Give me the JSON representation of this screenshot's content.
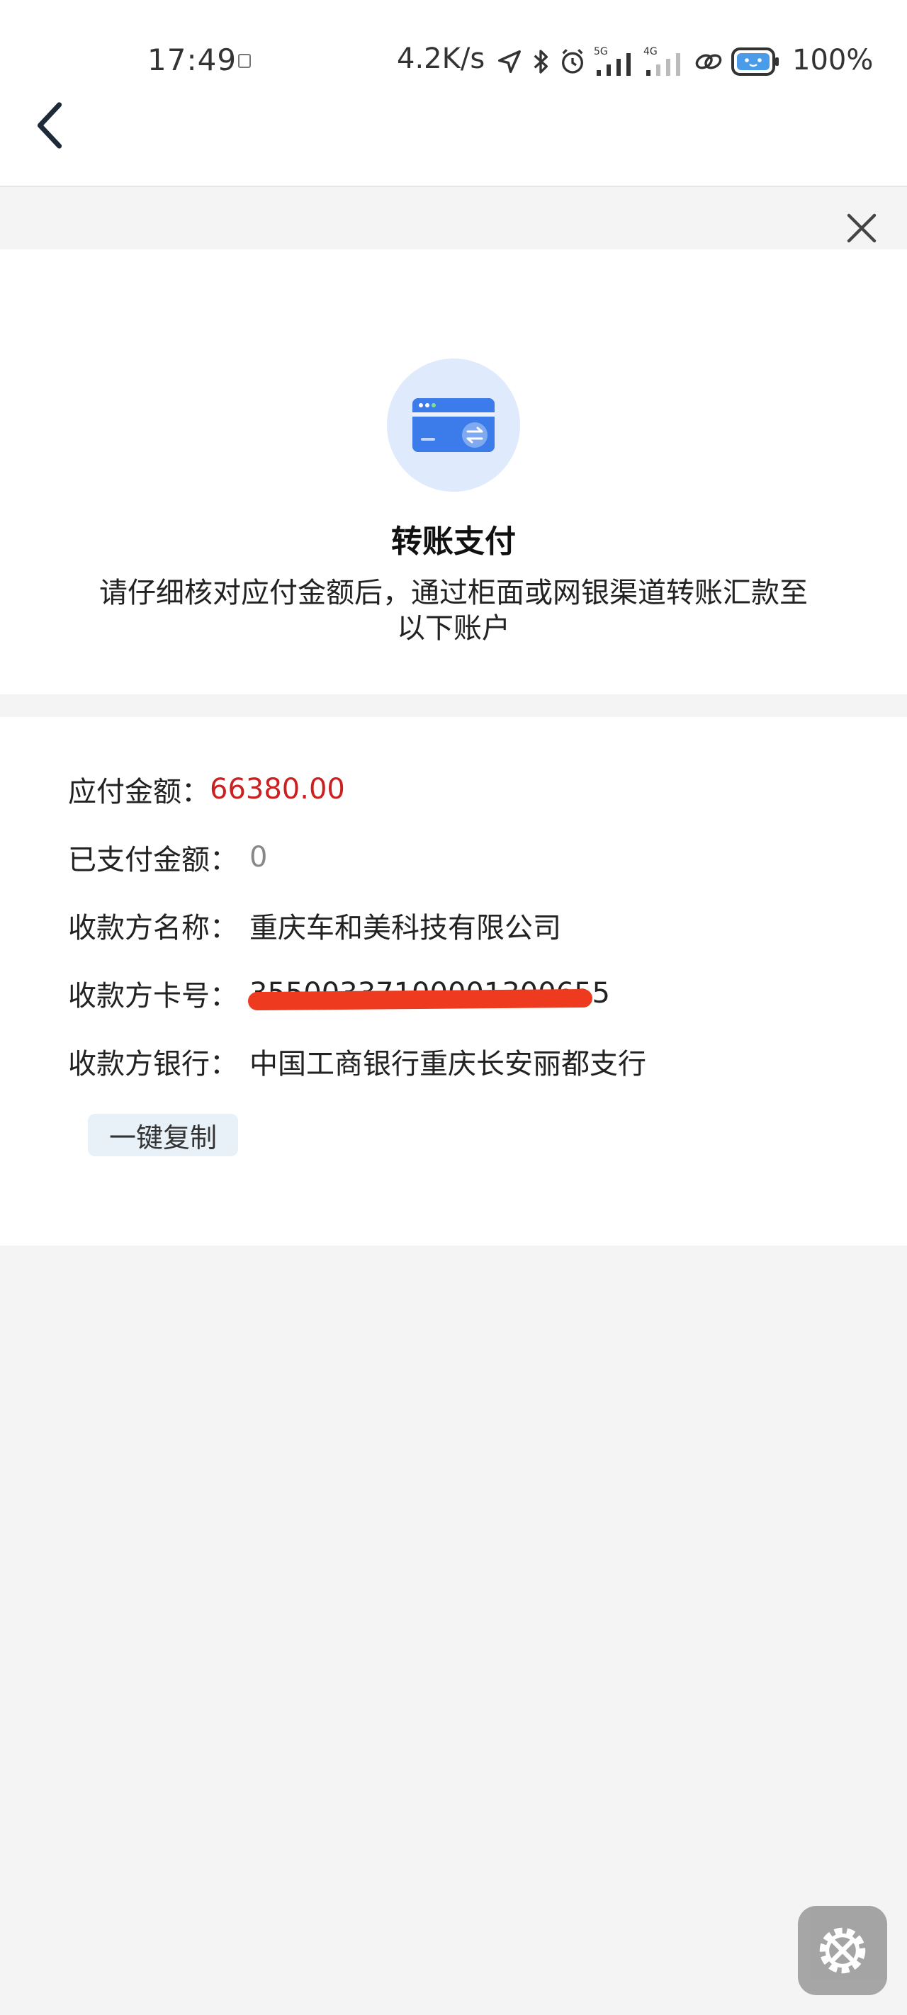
{
  "status_bar": {
    "time": "17:49",
    "speed": "4.2K/s",
    "signal_5g": "5G",
    "signal_4g": "4G",
    "battery": "100%"
  },
  "header_card": {
    "title": "转账支付",
    "description": "请仔细核对应付金额后，通过柜面或网银渠道转账汇款至以下账户"
  },
  "details": {
    "rows": [
      {
        "label": "应付金额：",
        "value": "66380.00"
      },
      {
        "label": "已支付金额：",
        "value": "0"
      },
      {
        "label": "收款方名称：",
        "value": "重庆车和美科技有限公司"
      },
      {
        "label": "收款方卡号：",
        "value": "35500337100001300655"
      },
      {
        "label": "收款方银行：",
        "value": "中国工商银行重庆长安丽都支行"
      }
    ],
    "copy_button": "一键复制"
  },
  "colors": {
    "amount_red": "#cc1f1f",
    "redaction": "#ee3a1e",
    "icon_blue": "#3b7bea",
    "icon_bg": "#dfeafc"
  }
}
